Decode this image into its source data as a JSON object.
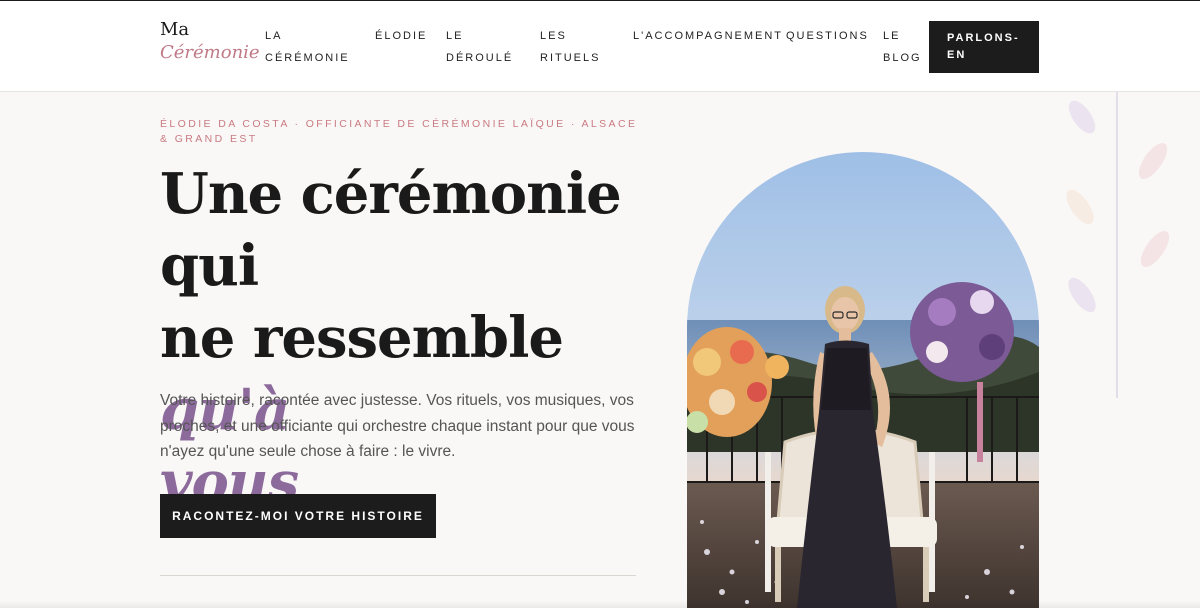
{
  "header": {
    "logo": {
      "line1": "Ma",
      "line2": "Cérémonie"
    },
    "nav": [
      {
        "line1": "LA",
        "line2": "CÉRÉMONIE"
      },
      {
        "line1": "ÉLODIE",
        "line2": ""
      },
      {
        "line1": "LE",
        "line2": "DÉROULÉ"
      },
      {
        "line1": "LES",
        "line2": "RITUELS"
      },
      {
        "line1": "L'ACCOMPAGNEMENT",
        "line2": ""
      },
      {
        "line1": "QUESTIONS",
        "line2": ""
      },
      {
        "line1": "LE",
        "line2": "BLOG"
      }
    ],
    "cta": {
      "line1": "PARLONS-",
      "line2": "EN"
    }
  },
  "hero": {
    "eyebrow": "ÉLODIE DA COSTA · OFFICIANTE DE CÉRÉMONIE LAÏQUE · ALSACE & GRAND EST",
    "headline_line1": "Une cérémonie qui",
    "headline_line2": "ne ressemble",
    "headline_accent1": "qu'à",
    "headline_accent2": "vous",
    "intro": "Votre histoire, racontée avec justesse. Vos rituels, vos musiques, vos proches, et une officiante qui orchestre chaque instant pour que vous n'ayez qu'une seule chose à faire : le vivre.",
    "button": "RACONTEZ-MOI VOTRE HISTOIRE"
  },
  "colors": {
    "accent_purple": "#8c6b9c",
    "accent_rose": "#c97a82",
    "dark": "#1c1c1c",
    "background": "#faf8f6"
  }
}
